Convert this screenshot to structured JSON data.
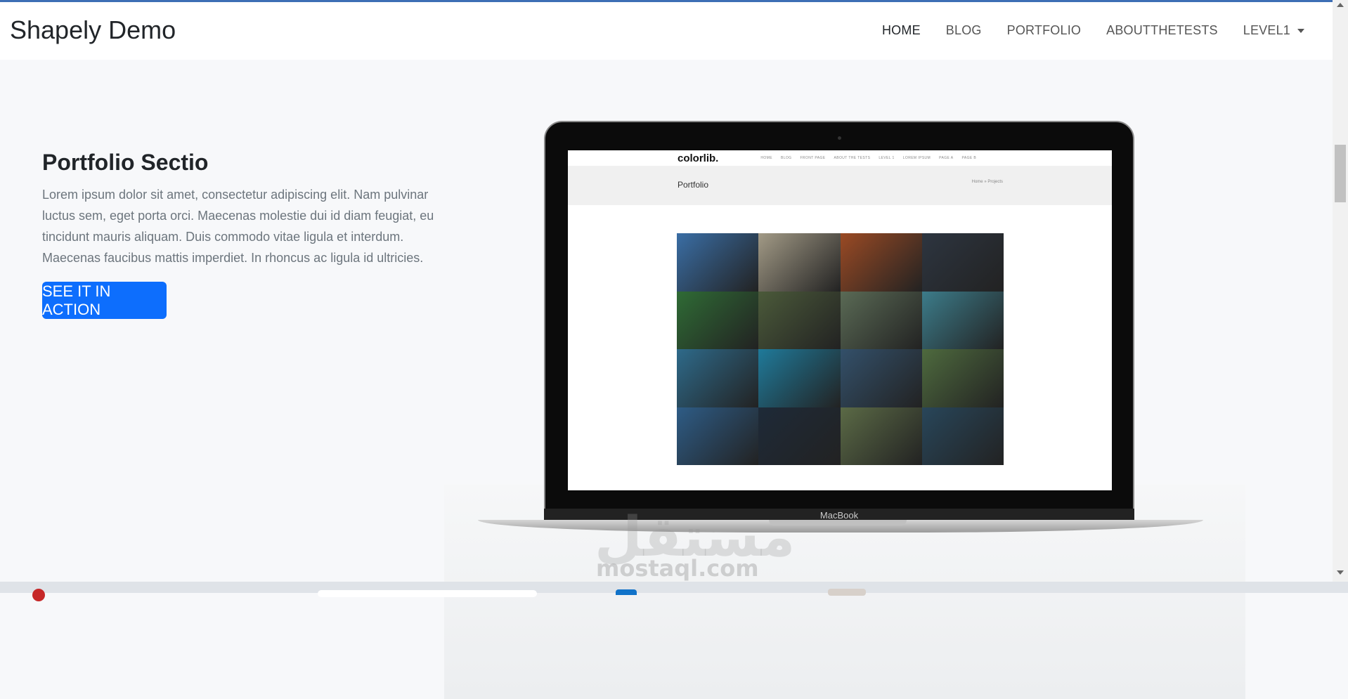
{
  "brand": "Shapely Demo",
  "nav": {
    "items": [
      "HOME",
      "BLOG",
      "PORTFOLIO",
      "ABOUTTHETESTS",
      "LEVEL1"
    ]
  },
  "hero": {
    "title": "Portfolio Sectio",
    "text": "Lorem ipsum dolor sit amet, consectetur adipiscing elit. Nam pulvinar luctus sem, eget porta orci. Maecenas molestie dui id diam feugiat, eu tincidunt mauris aliquam. Duis commodo vitae ligula et interdum. Maecenas faucibus mattis imperdiet. In rhoncus ac ligula id ultricies.",
    "button": "SEE IT IN ACTION"
  },
  "laptop": {
    "bezel_label": "MacBook",
    "screen": {
      "logo": "colorlib.",
      "links": [
        "HOME",
        "BLOG",
        "FRONT PAGE",
        "ABOUT THE TESTS",
        "LEVEL 1",
        "LOREM IPSUM",
        "PAGE A",
        "PAGE B"
      ],
      "page_title": "Portfolio",
      "breadcrumb": "Home » Projects",
      "tile_colors": [
        "#3a6ea5",
        "#a29a86",
        "#9a4a24",
        "#2d3540",
        "#2f6b35",
        "#4b5a3a",
        "#5a6a55",
        "#3c7c8a",
        "#2e6a8a",
        "#1f7a9a",
        "#33506a",
        "#4e6a3e",
        "#2e5c86",
        "#1e2a38",
        "#5b6a46",
        "#28465a"
      ]
    }
  },
  "watermark": {
    "arabic": "مستقل",
    "latin": "mostaql.com"
  },
  "colors": {
    "accent": "#0d6efd",
    "topline": "#3d6eb5"
  }
}
